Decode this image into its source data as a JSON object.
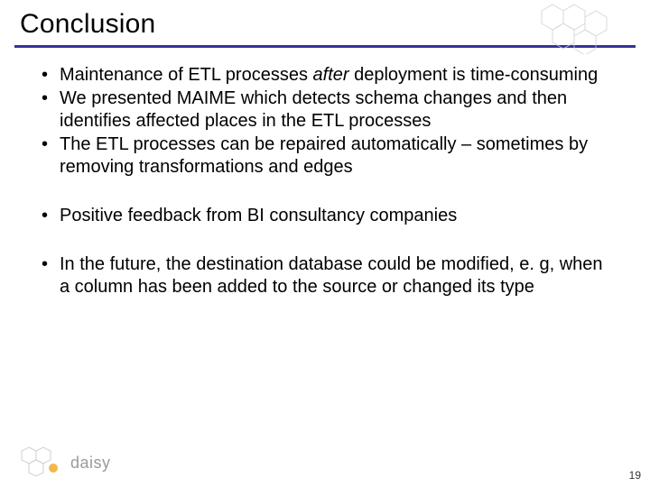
{
  "title": "Conclusion",
  "bullets": {
    "g1": [
      "Maintenance of ETL processes after deployment is time-consuming",
      "We presented MAIME which detects schema changes and then identifies affected places in the ETL processes",
      "The ETL processes can be repaired automatically – sometimes by removing transformations and edges"
    ],
    "g2": [
      "Positive feedback from BI consultancy companies"
    ],
    "g3": [
      "In the future, the destination database could be modified, e. g, when a column has been added to the source or changed its type"
    ]
  },
  "logo_text": "daisy",
  "page_number": "19"
}
